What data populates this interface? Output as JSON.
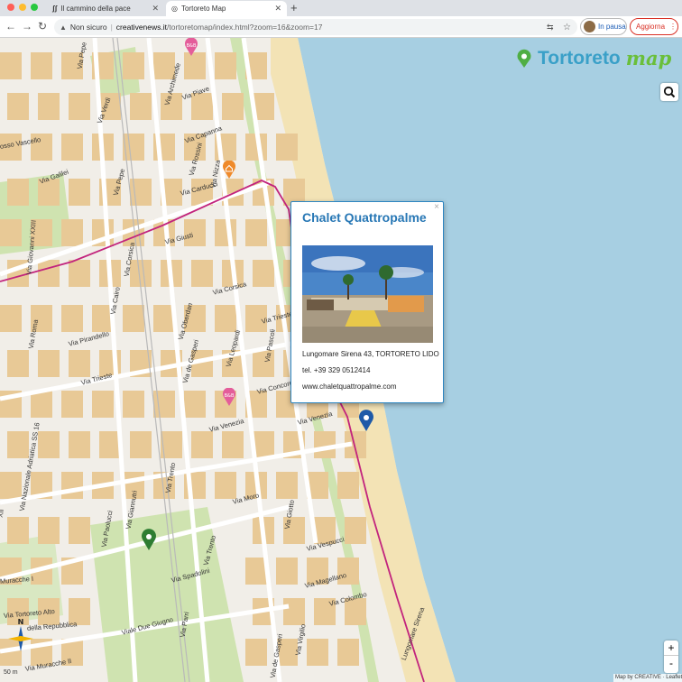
{
  "browser": {
    "tabs": [
      {
        "title": "Il cammino della pace",
        "icon": "quote-icon"
      },
      {
        "title": "Tortoreto Map",
        "icon": "globe-icon"
      }
    ],
    "address": {
      "security": "Non sicuro",
      "domain": "creativenews.it",
      "path": "/tortoretomap/index.html?zoom=16&zoom=17"
    },
    "pause_label": "In pausa",
    "update_label": "Aggiorna"
  },
  "logo": {
    "part1": "Tortoreto",
    "part2": "map"
  },
  "popup": {
    "title": "Chalet Quattropalme",
    "address": "Lungomare Sirena 43, TORTORETO LIDO",
    "phone": "tel. +39 329 0512414",
    "website": "www.chaletquattropalme.com"
  },
  "streets": [
    {
      "name": "Via Pepe",
      "key": "pepe1"
    },
    {
      "name": "Via Piave",
      "key": "piave"
    },
    {
      "name": "Via Capanna",
      "key": "capanna"
    },
    {
      "name": "Via Verdi",
      "key": "verdi"
    },
    {
      "name": "Via Archimede",
      "key": "archimede"
    },
    {
      "name": "Via Rossini",
      "key": "rossini"
    },
    {
      "name": "Via Nizza",
      "key": "nizza"
    },
    {
      "name": "Via Carducci",
      "key": "carducci"
    },
    {
      "name": "Via Galilei",
      "key": "galilei"
    },
    {
      "name": "Via Pepe",
      "key": "pepe2"
    },
    {
      "name": "osso Vascello",
      "key": "vascello"
    },
    {
      "name": "Via Giovanni XXIII",
      "key": "giovanni"
    },
    {
      "name": "Via Giusti",
      "key": "giusti"
    },
    {
      "name": "Via Corsica",
      "key": "corsica1"
    },
    {
      "name": "Via Cairo",
      "key": "cairo"
    },
    {
      "name": "Via Corsica",
      "key": "corsica2"
    },
    {
      "name": "Via Oberdan",
      "key": "oberdan"
    },
    {
      "name": "Via Trieste",
      "key": "trieste1"
    },
    {
      "name": "Via Roma",
      "key": "roma"
    },
    {
      "name": "Via Pirandello",
      "key": "pirandello"
    },
    {
      "name": "Via Leopardi",
      "key": "leopardi"
    },
    {
      "name": "Via Pascoli",
      "key": "pascoli"
    },
    {
      "name": "Via Trieste",
      "key": "trieste2"
    },
    {
      "name": "Via de Gasperi",
      "key": "gasperi1"
    },
    {
      "name": "Via Concordia",
      "key": "concordia"
    },
    {
      "name": "Via Venezia",
      "key": "venezia1"
    },
    {
      "name": "Via Venezia",
      "key": "venezia2"
    },
    {
      "name": "Via Nazionale Adriatica SS 16",
      "key": "nazionale"
    },
    {
      "name": "Via Giannutri",
      "key": "giannutri"
    },
    {
      "name": "Via Trento",
      "key": "trento1"
    },
    {
      "name": "Via Paolucci",
      "key": "paolucci"
    },
    {
      "name": "Via Moro",
      "key": "moro"
    },
    {
      "name": "Via Giotto",
      "key": "giotto"
    },
    {
      "name": "Via Trento",
      "key": "trento2"
    },
    {
      "name": "Via Vespucci",
      "key": "vespucci"
    },
    {
      "name": "Via Spadolini",
      "key": "spadolini"
    },
    {
      "name": "Via Magellano",
      "key": "magellano"
    },
    {
      "name": "Via Colombo",
      "key": "colombo"
    },
    {
      "name": "Lungomare Sirena",
      "key": "lungomare"
    },
    {
      "name": "Muracche I",
      "key": "muracche1"
    },
    {
      "name": "Via Tortoreto Alto",
      "key": "tortoreto"
    },
    {
      "name": "della Repubblica",
      "key": "repubblica"
    },
    {
      "name": "Viale Due Giugno",
      "key": "duegiugno"
    },
    {
      "name": "Via Parri",
      "key": "parri"
    },
    {
      "name": "Via Virgilio",
      "key": "virgilio"
    },
    {
      "name": "Via de Gasperi",
      "key": "gasperi2"
    },
    {
      "name": "Via Muracche II",
      "key": "muracche2"
    },
    {
      "name": "XII",
      "key": "xii"
    }
  ],
  "map_ui": {
    "zoom_in": "+",
    "zoom_out": "-",
    "attribution": "Map by CREATIVE · Leaflet",
    "scale": "50 m",
    "compass_north": "N"
  },
  "colors": {
    "sea": "#a7cfe2",
    "beach": "#f3e3b5",
    "land": "#f1eee8",
    "building": "#e8c996",
    "park": "#cfe3b0",
    "road": "#ffffff",
    "route": "#c2247d",
    "brand_blue": "#3aa0c8",
    "brand_green": "#6abf3a"
  }
}
